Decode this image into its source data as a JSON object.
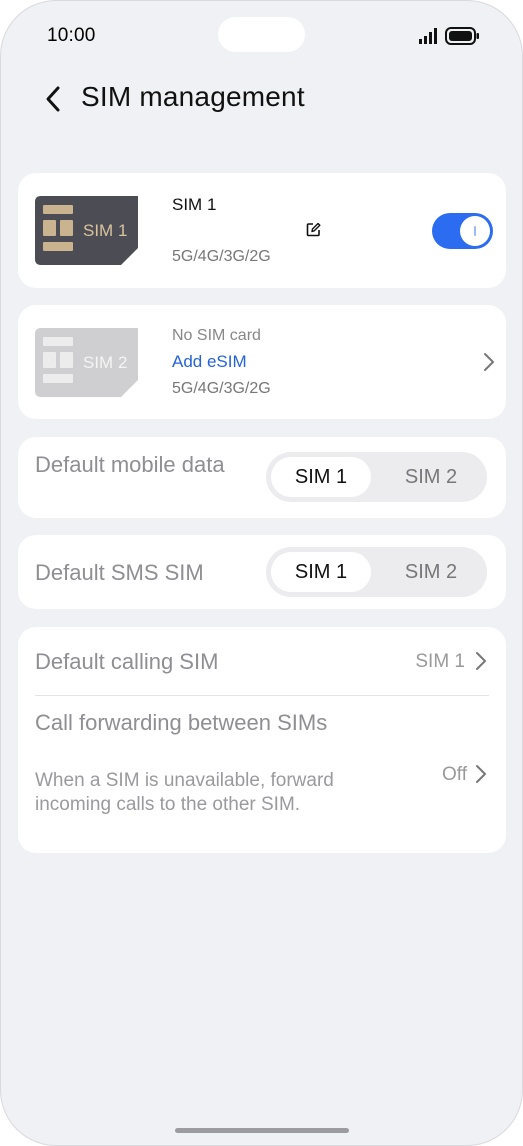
{
  "status_bar": {
    "time": "10:00"
  },
  "header": {
    "title": "SIM management"
  },
  "sim1": {
    "badge": "SIM 1",
    "name": "SIM 1",
    "network": "5G/4G/3G/2G",
    "enabled": true
  },
  "sim2": {
    "badge": "SIM 2",
    "status": "No SIM card",
    "action": "Add eSIM",
    "network": "5G/4G/3G/2G"
  },
  "default_mobile_data": {
    "label": "Default mobile data",
    "options": [
      "SIM 1",
      "SIM 2"
    ],
    "selected": "SIM 1"
  },
  "default_sms": {
    "label": "Default SMS SIM",
    "options": [
      "SIM 1",
      "SIM 2"
    ],
    "selected": "SIM 1"
  },
  "default_calling": {
    "label": "Default calling SIM",
    "value": "SIM 1"
  },
  "call_forwarding": {
    "label": "Call forwarding between SIMs",
    "description": "When a SIM is unavailable, forward incoming calls to the other SIM.",
    "value": "Off"
  },
  "colors": {
    "accent": "#2b6cf0",
    "link": "#2463d9",
    "background": "#f0f1f5"
  }
}
